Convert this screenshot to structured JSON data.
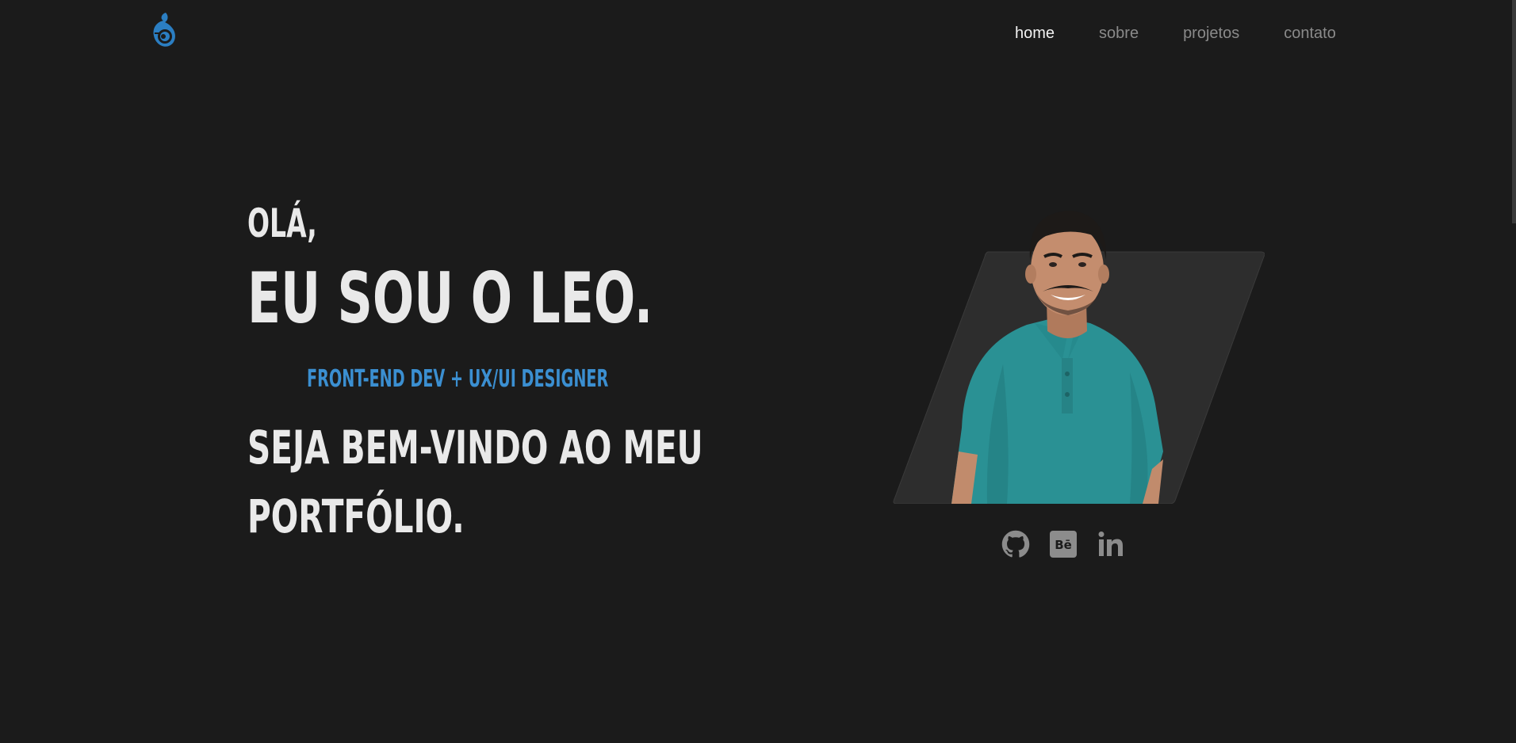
{
  "nav": {
    "items": [
      {
        "label": "home",
        "active": true
      },
      {
        "label": "sobre",
        "active": false
      },
      {
        "label": "projetos",
        "active": false
      },
      {
        "label": "contato",
        "active": false
      }
    ]
  },
  "hero": {
    "greeting": "OLÁ,",
    "name_line": "EU SOU O LEO.",
    "role": "FRONT-END DEV + UX/UI DESIGNER",
    "welcome_line_1": "SEJA BEM-VINDO AO MEU",
    "welcome_line_2": "PORTFÓLIO."
  },
  "social": {
    "icons": [
      "github-icon",
      "behance-icon",
      "linkedin-icon"
    ]
  },
  "colors": {
    "background": "#1b1b1b",
    "accent": "#3b8fd1",
    "heading": "#e9e9e9",
    "nav_inactive": "#8a8a8a",
    "icon": "#8c8c8c"
  }
}
